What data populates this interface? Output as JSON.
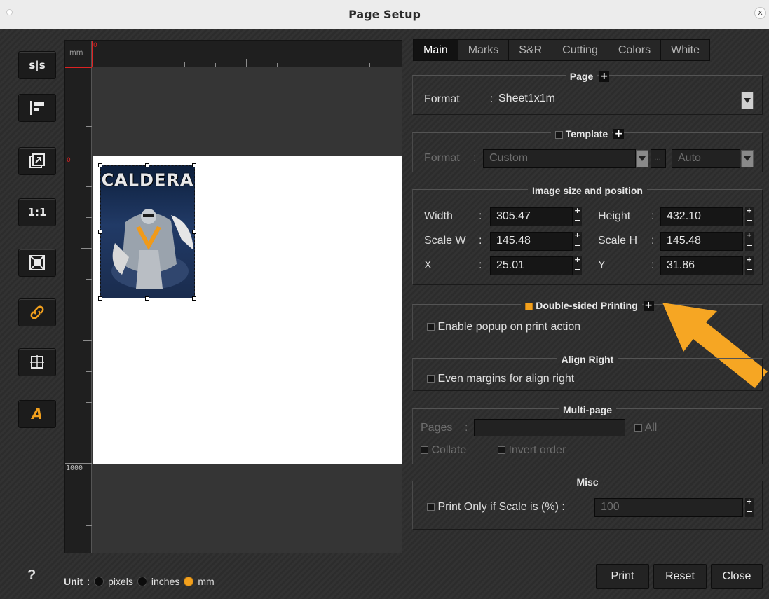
{
  "window": {
    "title": "Page Setup",
    "close_glyph": "x"
  },
  "toolbar": [
    {
      "name": "mirror-button",
      "label": "s|s"
    },
    {
      "name": "align-button",
      "label": ""
    },
    {
      "name": "fit-image-button",
      "label": ""
    },
    {
      "name": "actual-size-button",
      "label": "1:1"
    },
    {
      "name": "fit-page-button",
      "label": ""
    },
    {
      "name": "link-button",
      "label": ""
    },
    {
      "name": "center-button",
      "label": ""
    },
    {
      "name": "text-button",
      "label": "A"
    }
  ],
  "preview": {
    "ruler_unit": "mm",
    "ruler_zero": "0",
    "ruler_bottom_number": "1000",
    "image_text": "CALDERA"
  },
  "tabs": [
    {
      "label": "Main",
      "active": true
    },
    {
      "label": "Marks",
      "active": false
    },
    {
      "label": "S&R",
      "active": false
    },
    {
      "label": "Cutting",
      "active": false
    },
    {
      "label": "Colors",
      "active": false
    },
    {
      "label": "White",
      "active": false
    }
  ],
  "page": {
    "title": "Page",
    "format_label": "Format",
    "format_value": "Sheet1x1m"
  },
  "template": {
    "title": "Template",
    "format_label": "Format",
    "format_value": "Custom",
    "ellipsis": "...",
    "auto_value": "Auto"
  },
  "image": {
    "title": "Image size and position",
    "width_label": "Width",
    "width_value": "305.47",
    "height_label": "Height",
    "height_value": "432.10",
    "scalew_label": "Scale W",
    "scalew_value": "145.48",
    "scaleh_label": "Scale H",
    "scaleh_value": "145.48",
    "x_label": "X",
    "x_value": "25.01",
    "y_label": "Y",
    "y_value": "31.86"
  },
  "double_sided": {
    "title": "Double-sided Printing",
    "checked": true,
    "popup_label": "Enable popup on print action"
  },
  "align_right": {
    "title": "Align Right",
    "even_label": "Even margins for align right"
  },
  "multipage": {
    "title": "Multi-page",
    "pages_label": "Pages",
    "all_label": "All",
    "collate_label": "Collate",
    "invert_label": "Invert order"
  },
  "misc": {
    "title": "Misc",
    "print_only_label": "Print Only if Scale is (%)",
    "scale_value": "100"
  },
  "footer": {
    "help": "?",
    "unit_label": "Unit",
    "units": [
      {
        "label": "pixels",
        "selected": false
      },
      {
        "label": "inches",
        "selected": false
      },
      {
        "label": "mm",
        "selected": true
      }
    ],
    "print": "Print",
    "reset": "Reset",
    "close": "Close"
  },
  "colors": {
    "accent": "#f2a01d",
    "background": "#2f2f2f"
  }
}
